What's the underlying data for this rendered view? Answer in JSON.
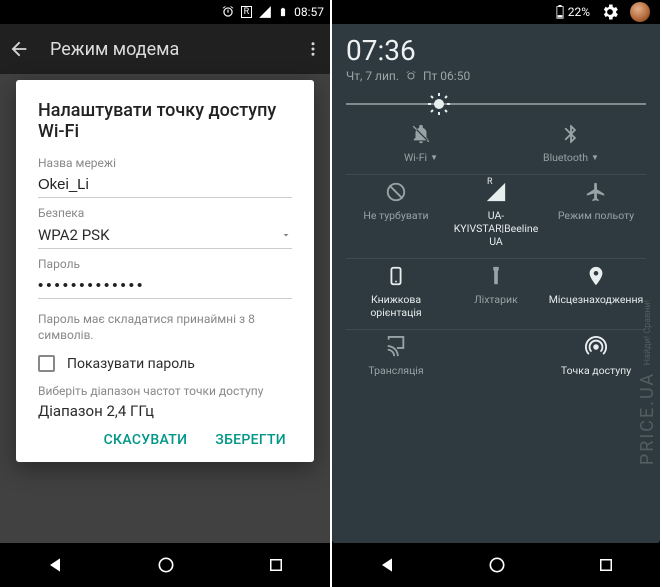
{
  "phone1": {
    "status": {
      "time": "08:57",
      "r_badge": "R"
    },
    "header": {
      "title": "Режим модема"
    },
    "dialog": {
      "title": "Налаштувати точку доступу Wi-Fi",
      "ssid_label": "Назва мережі",
      "ssid_value": "Okei_Li",
      "security_label": "Безпека",
      "security_value": "WPA2 PSK",
      "password_label": "Пароль",
      "password_value": "•••••••••••••",
      "hint": "Пароль має складатися принаймні з 8 символів.",
      "show_pwd_label": "Показувати пароль",
      "band_label": "Виберіть діапазон частот точки доступу",
      "band_value": "Діапазон 2,4 ГГц",
      "cancel": "СКАСУВАТИ",
      "save": "ЗБЕРЕГТИ"
    }
  },
  "phone2": {
    "status": {
      "battery_pct": "22%"
    },
    "clock": "07:36",
    "date": "Чт, 7 лип.",
    "alarm": "Пт 06:50",
    "tiles": {
      "wifi": "Wi-Fi",
      "bluetooth": "Bluetooth",
      "dnd": "Не турбувати",
      "carrier": "UA-KYIVSTAR|Beeline UA",
      "carrier_badge": "R",
      "airplane": "Режим польоту",
      "rotation": "Книжкова орієнтація",
      "flashlight": "Ліхтарик",
      "location": "Місцезнаходження",
      "cast": "Трансляція",
      "hotspot": "Точка доступу"
    }
  },
  "watermark": {
    "brand": "PRICE.UA",
    "tag": "Найди! Сравни!"
  }
}
